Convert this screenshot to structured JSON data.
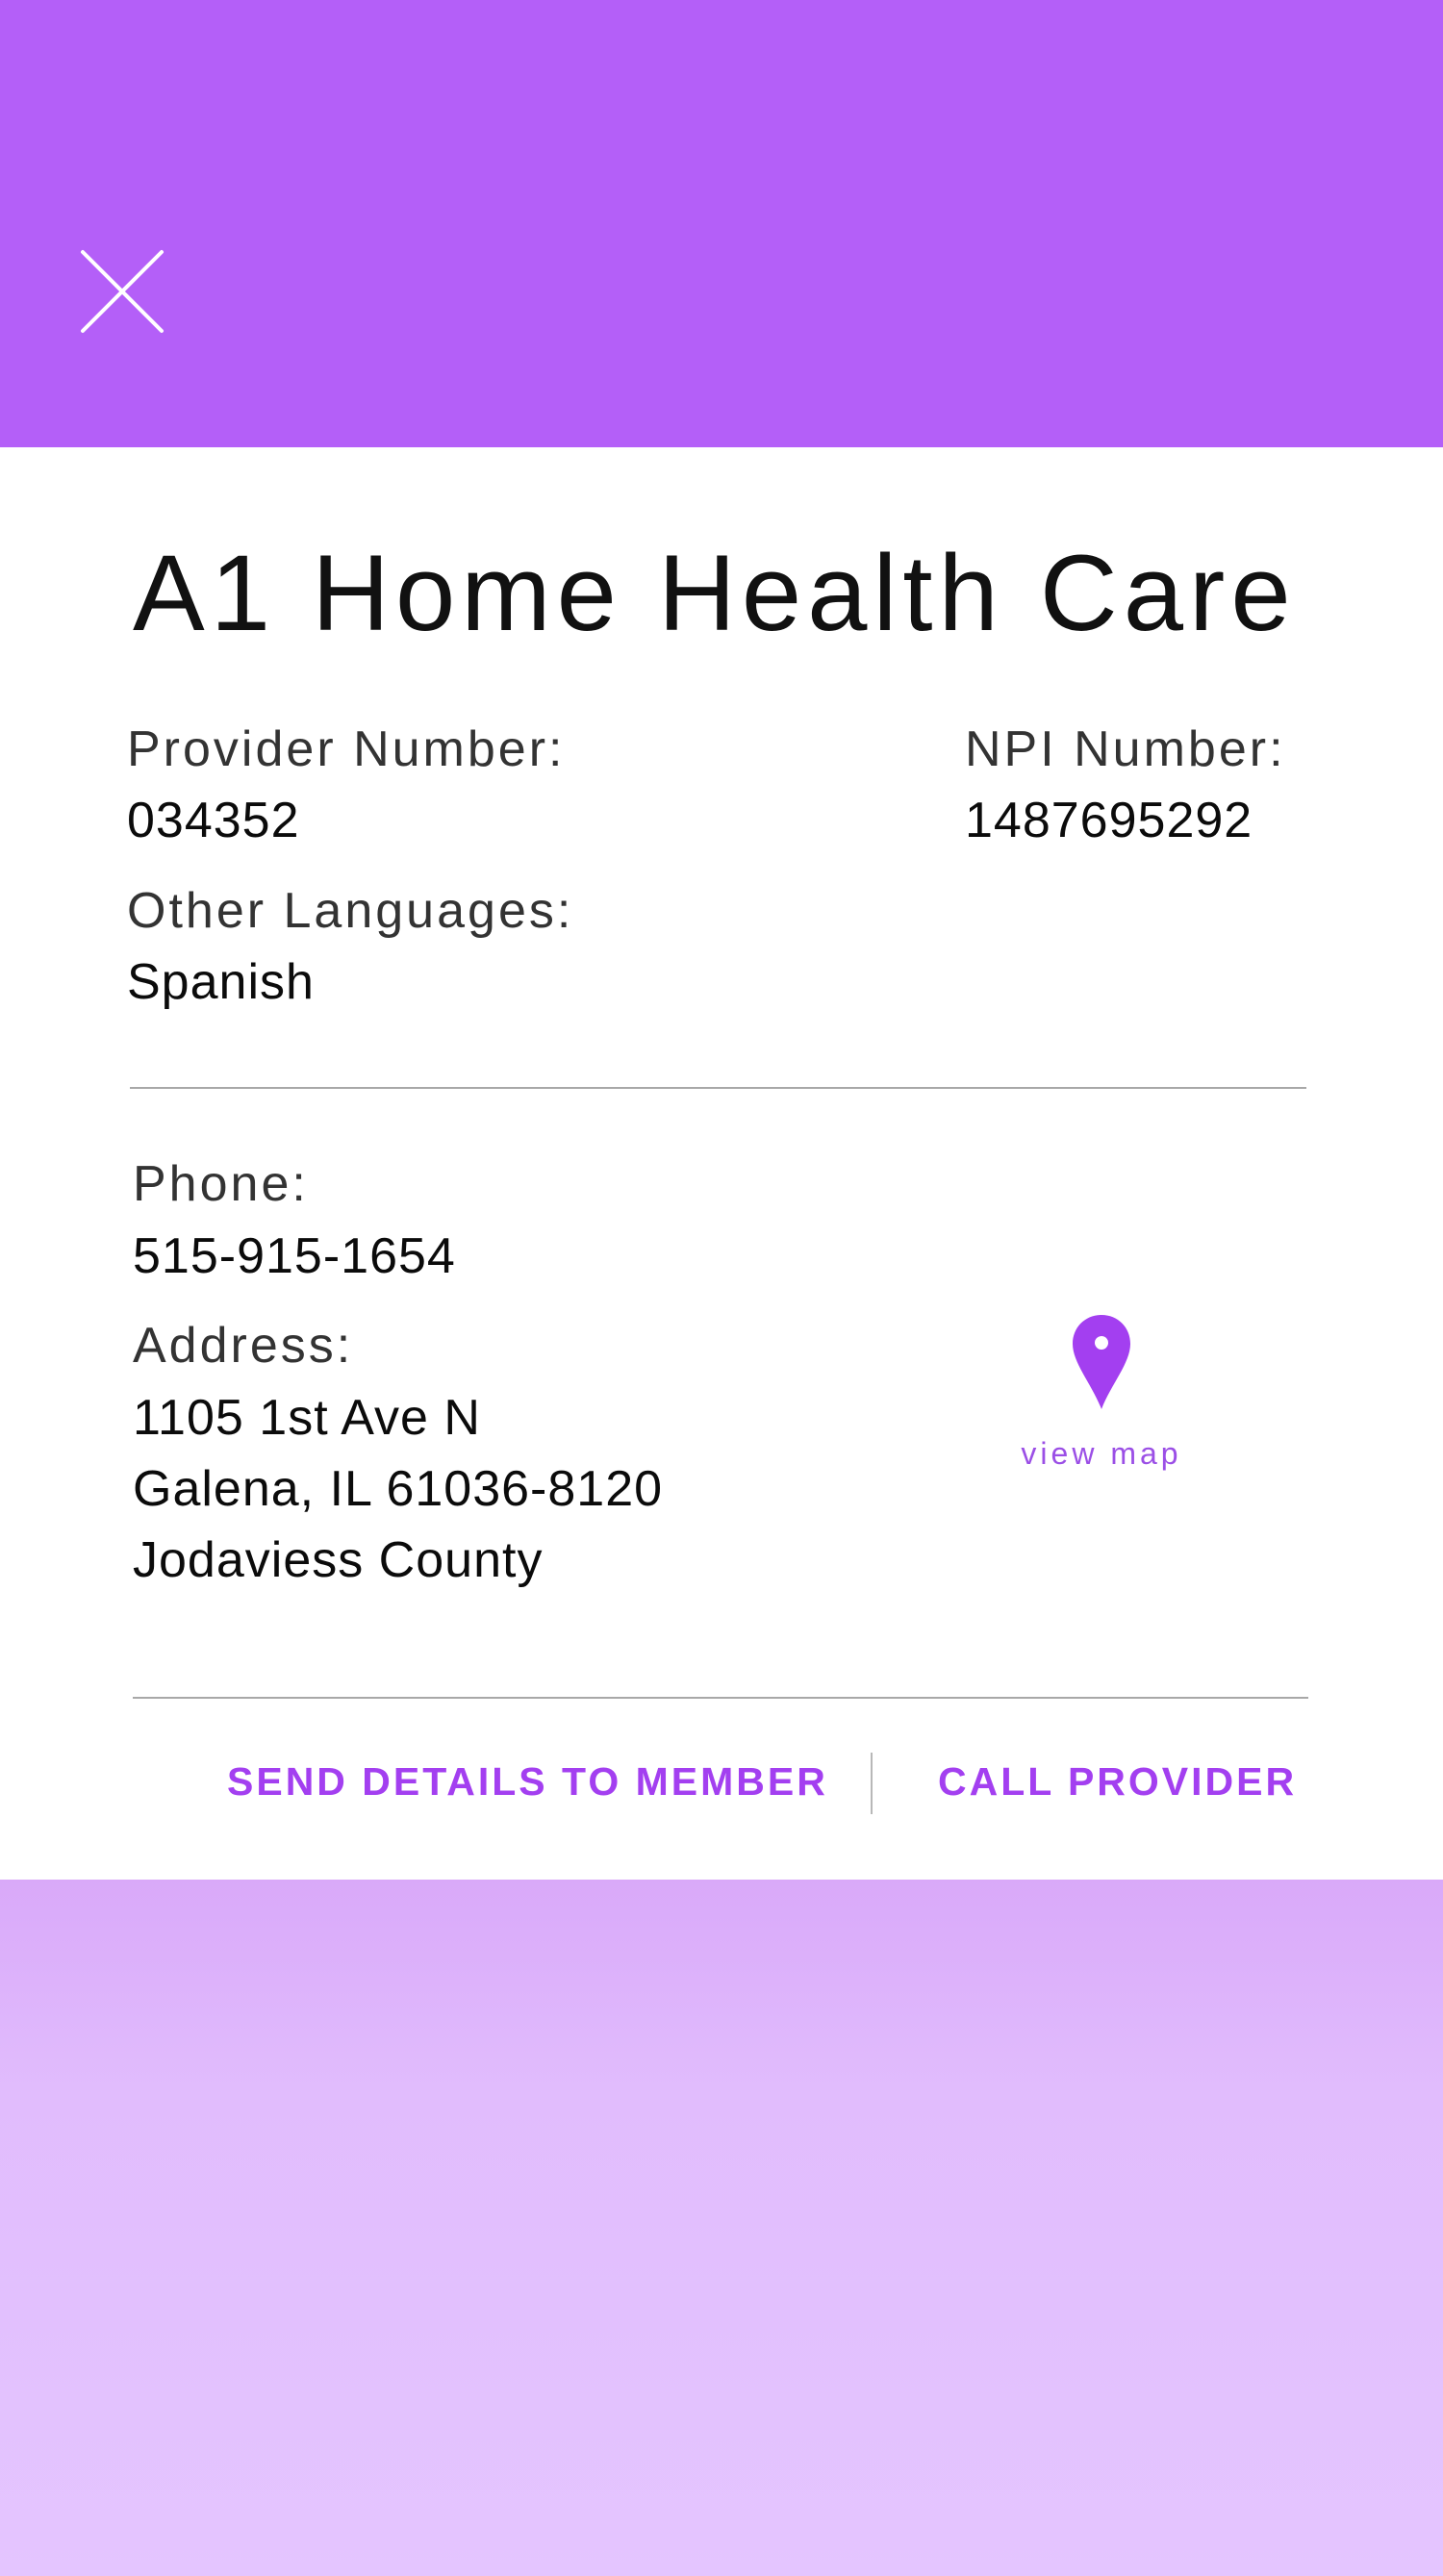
{
  "provider": {
    "name": "A1 Home Health Care",
    "provider_number_label": "Provider Number:",
    "provider_number": "034352",
    "npi_label": "NPI Number:",
    "npi_number": "1487695292",
    "languages_label": "Other Languages:",
    "languages": "Spanish"
  },
  "contact": {
    "phone_label": "Phone:",
    "phone": "515-915-1654",
    "address_label": "Address:",
    "address_line1": "1105 1st Ave N",
    "address_line2": "Galena, IL 61036-8120",
    "address_line3": "Jodaviess County"
  },
  "map": {
    "label": "view map",
    "icon": "map-pin-icon"
  },
  "actions": {
    "send_details": "SEND DETAILS TO MEMBER",
    "call_provider": "CALL PROVIDER"
  },
  "header": {
    "close_icon": "close-icon"
  },
  "colors": {
    "header_bg": "#b45ff8",
    "accent": "#a33ff0",
    "footer_top": "#d9a9f9",
    "footer_bottom": "#e4c5ff"
  }
}
